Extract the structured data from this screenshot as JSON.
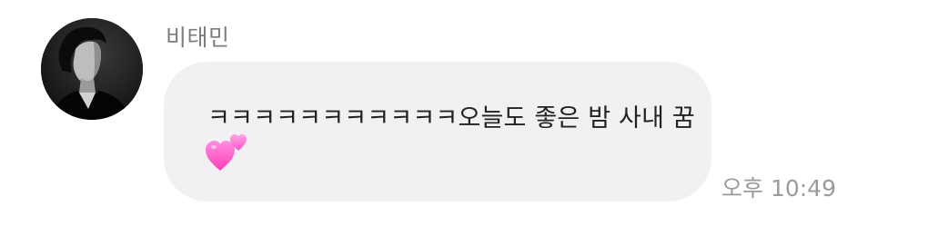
{
  "sender": {
    "name": "비태민",
    "avatar_icon": "profile-photo"
  },
  "message": {
    "text": "ㅋㅋㅋㅋㅋㅋㅋㅋㅋㅋㅋ오늘도 좋은 밤 사내 꿈",
    "emoji": "two-hearts-icon",
    "timestamp": "오후 10:49"
  },
  "colors": {
    "bubble_background": "#f1f1f4",
    "name_text": "#7d7d7d",
    "message_text": "#222222",
    "timestamp_text": "#9b9b9b",
    "heart_pink": "#ff5fc8"
  }
}
